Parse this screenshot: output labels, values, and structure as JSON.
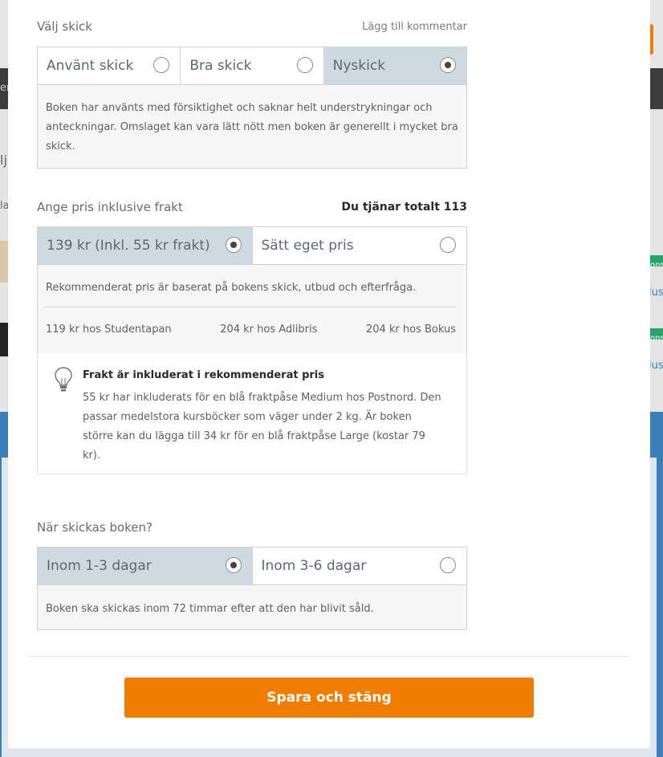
{
  "background": {
    "side_text_top": "er",
    "side_text_mid": "lj",
    "side_text_low": "la",
    "link_text": "ius",
    "badge_text": "ons",
    "colors": {
      "blue": "#3a7fb8",
      "dark_bar": "#3c3c3c",
      "green": "#2aa36a"
    }
  },
  "condition": {
    "title": "Välj skick",
    "comment_link": "Lägg till kommentar",
    "options": [
      {
        "label": "Använt skick",
        "selected": false
      },
      {
        "label": "Bra skick",
        "selected": false
      },
      {
        "label": "Nyskick",
        "selected": true
      }
    ],
    "description": "Boken har använts med försiktighet och saknar helt understrykningar och anteckningar. Omslaget kan vara lätt nött men boken är generellt i mycket bra skick."
  },
  "price": {
    "title": "Ange pris inklusive frakt",
    "earnings": "Du tjänar totalt 113",
    "options": [
      {
        "label": "139 kr (Inkl. 55 kr frakt)",
        "selected": true
      },
      {
        "label": "Sätt eget pris",
        "selected": false
      }
    ],
    "description": "Rekommenderat pris är baserat på bokens skick, utbud och efterfråga.",
    "comparisons": [
      "119 kr hos Studentapan",
      "204 kr hos Adlibris",
      "204 kr hos Bokus"
    ],
    "info_icon": "lightbulb-icon",
    "info_title": "Frakt är inkluderat i rekommenderat pris",
    "info_body": "55 kr har inkluderats för en blå fraktpåse Medium hos Postnord. Den passar medelstora kursböcker som väger under 2 kg. Är boken större kan du lägga till 34 kr för en blå fraktpåse Large (kostar 79 kr)."
  },
  "shipping": {
    "title": "När skickas boken?",
    "options": [
      {
        "label": "Inom 1-3 dagar",
        "selected": true
      },
      {
        "label": "Inom 3-6 dagar",
        "selected": false
      }
    ],
    "description": "Boken ska skickas inom 72 timmar efter att den har blivit såld."
  },
  "save_button": "Spara och stäng",
  "colors": {
    "accent": "#f07c00",
    "selected": "#cfdae0",
    "border": "#cfd3d6"
  }
}
